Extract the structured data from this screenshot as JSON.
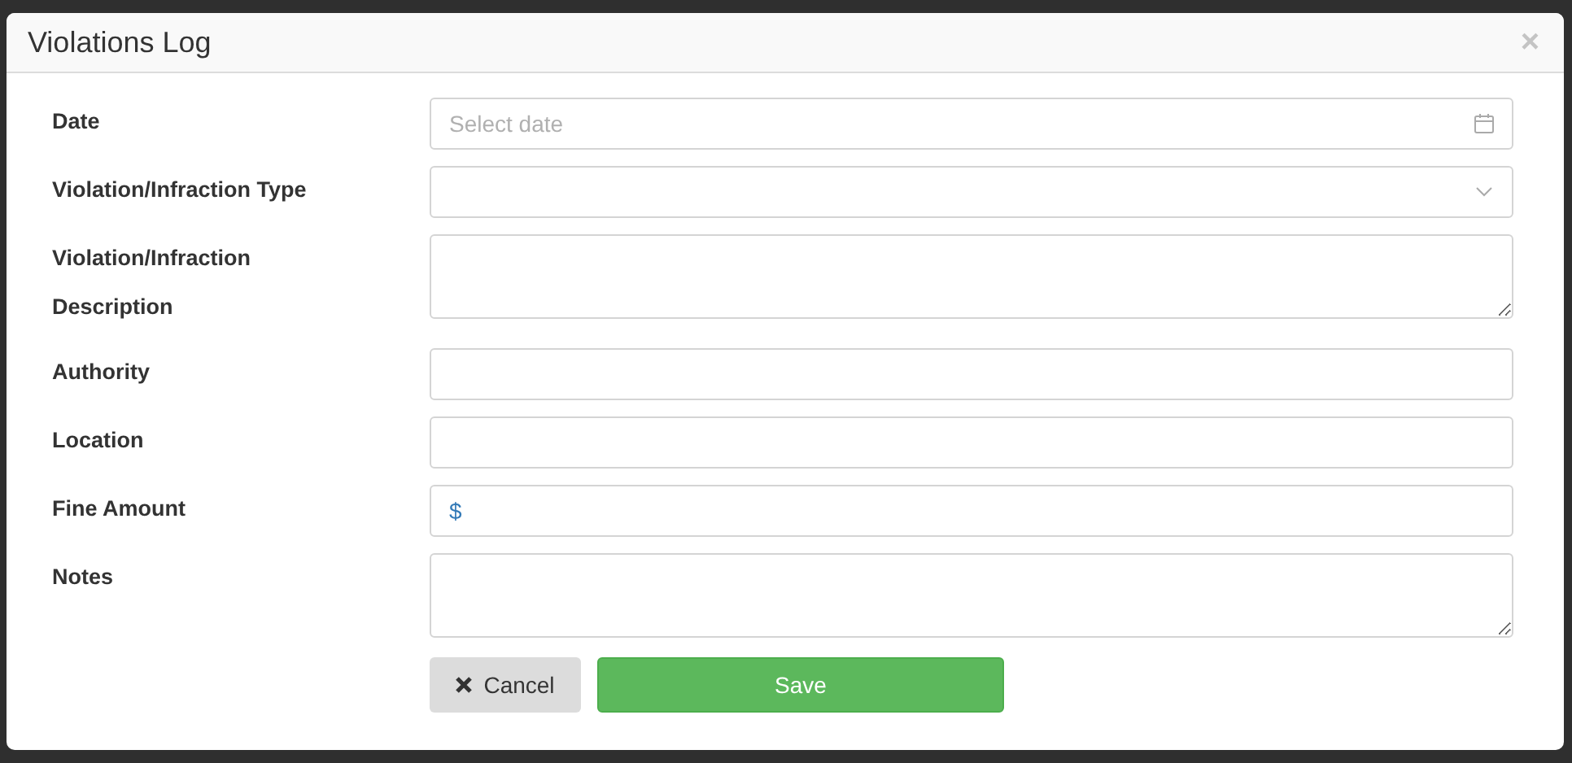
{
  "modal": {
    "title": "Violations Log",
    "close": "×",
    "fields": [
      {
        "kind": "date",
        "label": "Date",
        "placeholder": "Select date"
      },
      {
        "kind": "select",
        "label": "Violation/Infraction Type"
      },
      {
        "kind": "textarea",
        "label": "Violation/Infraction Description"
      },
      {
        "kind": "text",
        "label": "Authority"
      },
      {
        "kind": "text",
        "label": "Location"
      },
      {
        "kind": "money",
        "label": "Fine Amount",
        "prefix": "$"
      },
      {
        "kind": "textarea",
        "label": "Notes"
      }
    ],
    "buttons": [
      {
        "kind": "cancel",
        "label": "Cancel"
      },
      {
        "kind": "save",
        "label": "Save"
      }
    ]
  }
}
